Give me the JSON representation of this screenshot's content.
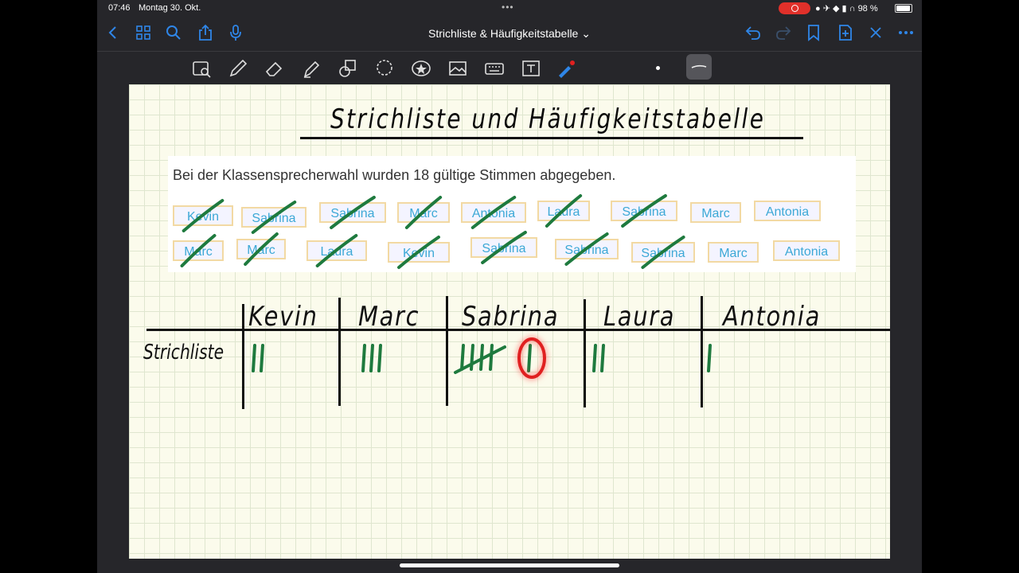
{
  "status": {
    "time": "07:46",
    "date": "Montag 30. Okt.",
    "battery": "98 %"
  },
  "nav": {
    "title": "Strichliste & Häufigkeitstabelle ⌄"
  },
  "page": {
    "title": "Strichliste und Häufigkeitstabelle",
    "problem": "Bei der Klassensprecherwahl wurden 18 gültige Stimmen abgegeben.",
    "cards_row1": [
      "Kevin",
      "Sabrina",
      "Sabrina",
      "Marc",
      "Antonia",
      "Laura",
      "Sabrina",
      "Marc",
      "Antonia"
    ],
    "cards_row2": [
      "Marc",
      "Marc",
      "Laura",
      "Kevin",
      "Sabrina",
      "Sabrina",
      "Sabrina",
      "Marc",
      "Antonia"
    ],
    "crossed_row1": [
      true,
      true,
      true,
      true,
      true,
      true,
      true,
      false,
      false
    ],
    "crossed_row2": [
      true,
      true,
      true,
      true,
      true,
      true,
      true,
      false,
      false
    ],
    "table": {
      "row_label": "Strichliste",
      "headers": [
        "Kevin",
        "Marc",
        "Sabrina",
        "Laura",
        "Antonia"
      ],
      "tallies": [
        2,
        3,
        6,
        2,
        1
      ]
    },
    "colors": {
      "ink": "#111111",
      "green": "#1e7a3e",
      "red": "#e02020",
      "card_text": "#3ca8d6"
    }
  }
}
